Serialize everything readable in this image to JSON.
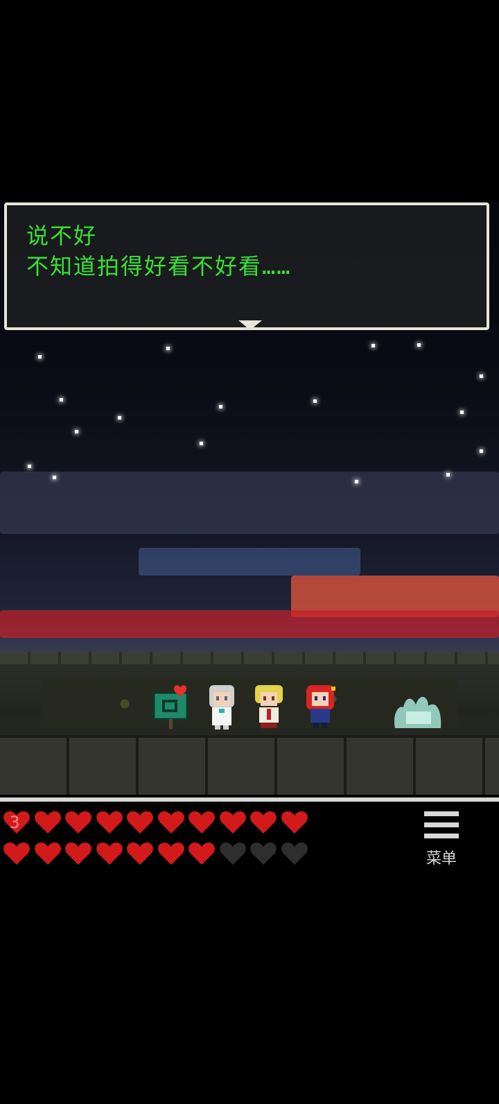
{
  "dialog": {
    "line1": "说不好",
    "line2": "不知道拍得好看不好看……"
  },
  "hud": {
    "heart_count": "3",
    "hearts_total": 20,
    "hearts_full": 17,
    "colors": {
      "heart_full": "#d21a1a",
      "heart_empty": "#2e2e2e",
      "dialog_text": "#36e233"
    }
  },
  "menu": {
    "label": "菜单",
    "icon": "hamburger-menu-icon"
  },
  "scene": {
    "characters": [
      "mailbox-with-heart",
      "white-haired-girl",
      "blonde-boy",
      "red-haired-girl",
      "ghost-slime"
    ]
  }
}
